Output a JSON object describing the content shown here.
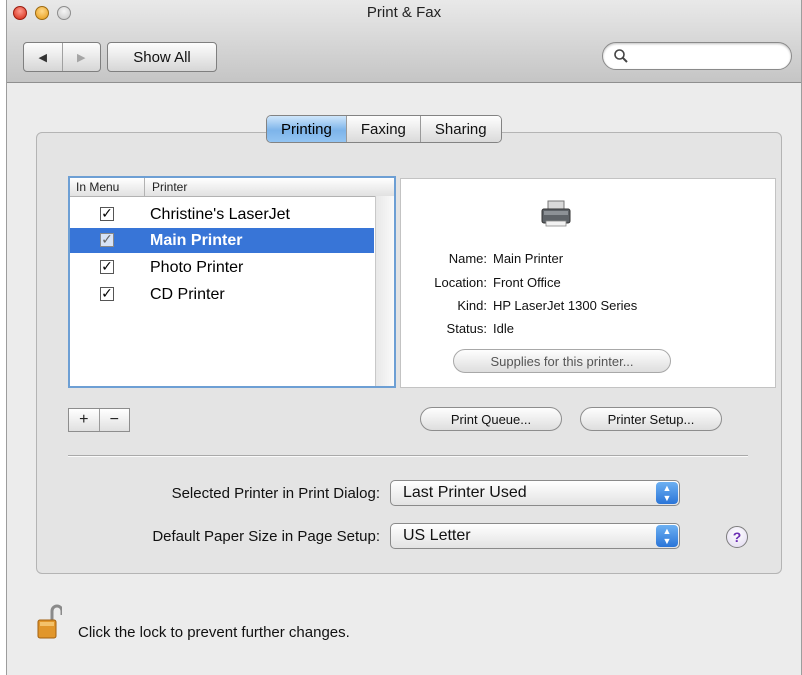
{
  "window": {
    "title": "Print & Fax"
  },
  "toolbar": {
    "back_glyph": "◀",
    "forward_glyph": "▶",
    "show_all_label": "Show All",
    "search_placeholder": ""
  },
  "tabs": [
    {
      "label": "Printing",
      "active": true
    },
    {
      "label": "Faxing",
      "active": false
    },
    {
      "label": "Sharing",
      "active": false
    }
  ],
  "printer_list": {
    "col_in_menu": "In Menu",
    "col_printer": "Printer",
    "rows": [
      {
        "label": "Christine's LaserJet",
        "in_menu": true,
        "selected": false
      },
      {
        "label": "Main Printer",
        "in_menu": true,
        "selected": true
      },
      {
        "label": "Photo Printer",
        "in_menu": true,
        "selected": false
      },
      {
        "label": "CD Printer",
        "in_menu": true,
        "selected": false
      }
    ]
  },
  "details": {
    "name_key": "Name:",
    "name_val": "Main Printer",
    "location_key": "Location:",
    "location_val": "Front Office",
    "kind_key": "Kind:",
    "kind_val": "HP LaserJet 1300 Series",
    "status_key": "Status:",
    "status_val": "Idle",
    "supplies_label": "Supplies for this printer..."
  },
  "actions": {
    "add_label": "+",
    "remove_label": "−",
    "print_queue_label": "Print Queue...",
    "printer_setup_label": "Printer Setup..."
  },
  "settings": {
    "selected_printer_label": "Selected Printer in Print Dialog:",
    "selected_printer_value": "Last Printer Used",
    "paper_size_label": "Default Paper Size in Page Setup:",
    "paper_size_value": "US Letter"
  },
  "help_label": "?",
  "lock_text": "Click the lock to prevent further changes.",
  "colors": {
    "selection": "#3875d7",
    "tab_active": "#7db4ea",
    "help_accent": "#6c2eb4"
  }
}
